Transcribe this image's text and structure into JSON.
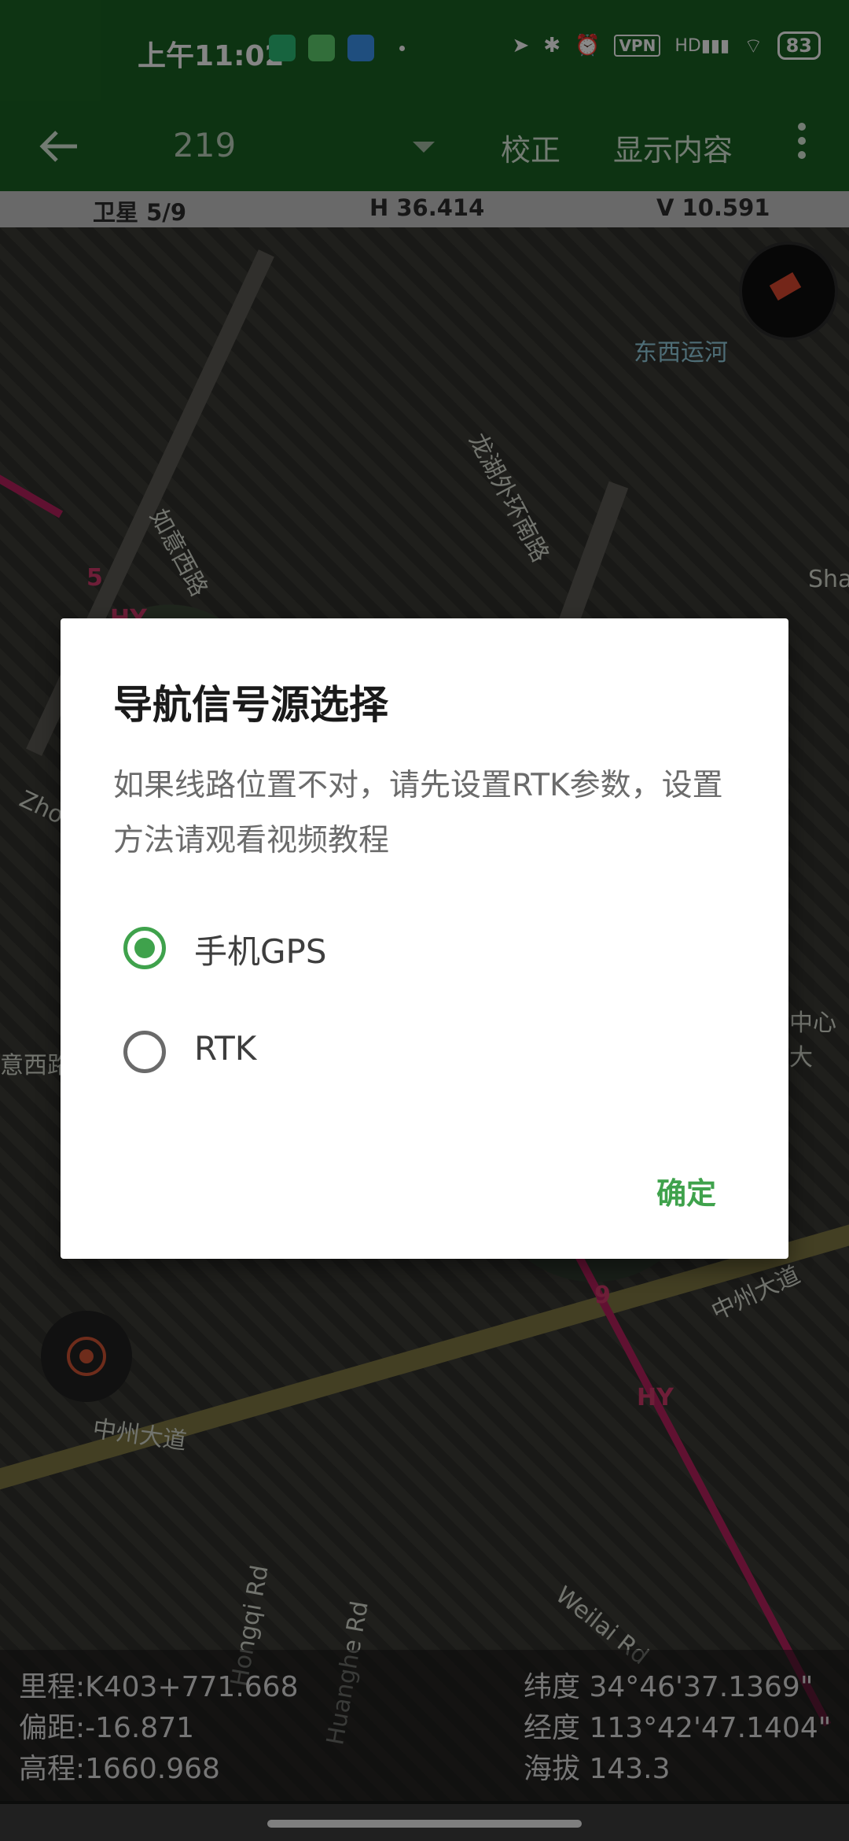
{
  "status_bar": {
    "time": "上午11:02",
    "vpn": "VPN",
    "battery": "83",
    "signal_tag": "HD"
  },
  "app_bar": {
    "route_value": "219",
    "calibrate": "校正",
    "display_content": "显示内容"
  },
  "info_bar": {
    "satellite": "卫星 5/9",
    "h": "H 36.414",
    "v": "V 10.591"
  },
  "map": {
    "labels": [
      "东西运河",
      "龙湖外环南路",
      "如意西路",
      "中州大道",
      "中州大道",
      "Zho",
      "Sha",
      "中心大",
      "Weilai Rd",
      "Huanghe Rd",
      "Hongqi Rd",
      "意西路",
      "HY",
      "HY",
      "5",
      "9"
    ]
  },
  "readout": {
    "mileage": "里程:K403+771.668",
    "offset": "偏距:-16.871",
    "elevation": "高程:1660.968",
    "latitude": "纬度 34°46'37.1369\"",
    "longitude": "经度 113°42'47.1404\"",
    "altitude": "海拔 143.3"
  },
  "dialog": {
    "title": "导航信号源选择",
    "message": "如果线路位置不对，请先设置RTK参数，设置方法请观看视频教程",
    "options": [
      {
        "label": "手机GPS",
        "selected": true
      },
      {
        "label": "RTK",
        "selected": false
      }
    ],
    "confirm": "确定"
  },
  "colors": {
    "accent": "#3fa24c",
    "appbar": "#195e22"
  }
}
